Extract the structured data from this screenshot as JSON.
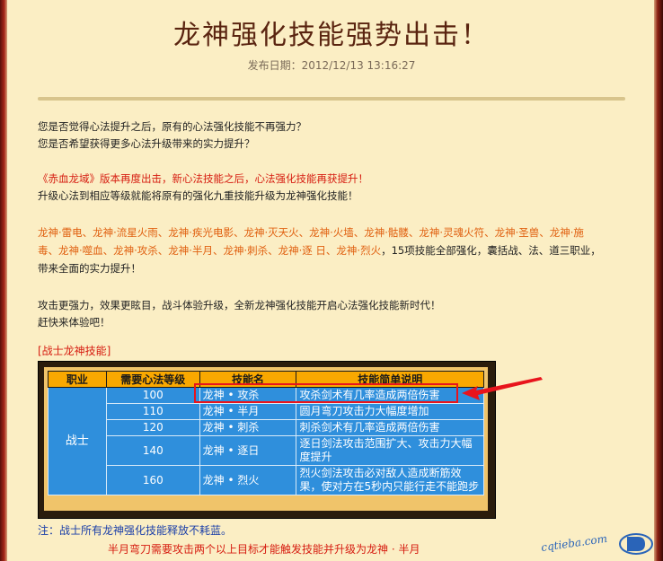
{
  "article": {
    "title": "龙神强化技能强势出击！",
    "publish_date": "发布日期：2012/12/13 13:16:27"
  },
  "intro": {
    "line1": "您是否觉得心法提升之后，原有的心法强化技能不再强力？",
    "line2": "您是否希望获得更多心法升级带来的实力提升？"
  },
  "announce": {
    "line1": "《赤血龙域》版本再度出击，新心法技能之后，心法强化技能再获提升！",
    "line2": "升级心法到相应等级就能将原有的强化九重技能升级为龙神强化技能！"
  },
  "skills_para": {
    "line1_orange": "龙神·雷电、龙神·流星火雨、龙神·疾光电影、龙神·灭天火、龙神·火墙、龙神·骷髅、龙神·灵魂火符、龙神·圣兽、龙神·施",
    "line2_orange": "毒、龙神·噬血、龙神·攻杀、龙神·半月、龙神·刺杀、龙神·逐 日、龙神·烈火",
    "line2_black": "，15项技能全部强化，囊括战、法、道三职业，",
    "line3": "带来全面的实力提升！"
  },
  "outro": {
    "line1": "攻击更强力，效果更眩目，战斗体验升级，全新龙神强化技能开启心法强化技能新时代！",
    "line2": "赶快来体验吧！"
  },
  "warrior_section_title": "[战士龙神技能]",
  "table": {
    "headers": [
      "职业",
      "需要心法等级",
      "技能名",
      "技能简单说明"
    ],
    "job": "战士",
    "rows": [
      {
        "level": "100",
        "name": "龙神 • 攻杀",
        "desc": "攻杀剑术有几率造成两倍伤害"
      },
      {
        "level": "110",
        "name": "龙神 • 半月",
        "desc": "圆月弯刀攻击力大幅度增加"
      },
      {
        "level": "120",
        "name": "龙神 • 刺杀",
        "desc": "刺杀剑术有几率造成两倍伤害"
      },
      {
        "level": "140",
        "name": "龙神 • 逐日",
        "desc": "逐日剑法攻击范围扩大、攻击力大幅度提升"
      },
      {
        "level": "160",
        "name": "龙神 • 烈火",
        "desc": "烈火剑法攻击必对敌人造成断筋效果，使对方在5秒内只能行走不能跑步"
      }
    ]
  },
  "notes": {
    "note1": "注：战士所有龙神强化技能释放不耗蓝。",
    "note2": "半月弯刀需要攻击两个以上目标才能触发技能并升级为龙神 · 半月"
  },
  "watermark": {
    "text": "cqtieba.com"
  },
  "colors": {
    "background": "#fbeec4",
    "title": "#5a2410",
    "accent_red": "#d61c10",
    "accent_orange": "#e06010",
    "table_header": "#f9a800",
    "table_cell": "#2f8fdc",
    "highlight": "#e8141c"
  }
}
